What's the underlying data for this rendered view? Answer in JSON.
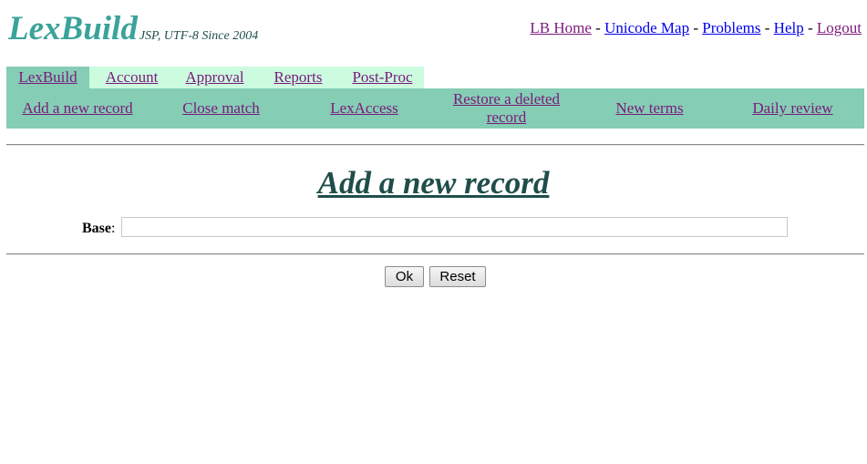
{
  "header": {
    "logo": "LexBuild",
    "tagline": "JSP, UTF-8 Since 2004",
    "links": [
      {
        "label": "LB Home",
        "visited": true
      },
      {
        "label": "Unicode Map",
        "visited": false
      },
      {
        "label": "Problems",
        "visited": false
      },
      {
        "label": "Help",
        "visited": false
      },
      {
        "label": "Logout",
        "visited": true
      }
    ],
    "separator": " - "
  },
  "tabs": [
    {
      "label": "LexBuild",
      "active": true
    },
    {
      "label": "Account",
      "active": false
    },
    {
      "label": "Approval",
      "active": false
    },
    {
      "label": "Reports",
      "active": false
    },
    {
      "label": "Post-Proc",
      "active": false
    }
  ],
  "subnav": [
    {
      "label": "Add a new record"
    },
    {
      "label": "Close match"
    },
    {
      "label": "LexAccess"
    },
    {
      "label": "Restore a deleted record"
    },
    {
      "label": "New terms"
    },
    {
      "label": "Daily review"
    }
  ],
  "main": {
    "title": "Add a new record",
    "base_label": "Base",
    "base_value": "",
    "ok_label": "Ok",
    "reset_label": "Reset"
  },
  "colors": {
    "logo": "#3aa39a",
    "subnav_bg": "#85cdb5",
    "tab_bg": "#ccfbe0",
    "title": "#1f4e4a",
    "visited_link": "#7a1a7a",
    "link": "#0000ee"
  }
}
